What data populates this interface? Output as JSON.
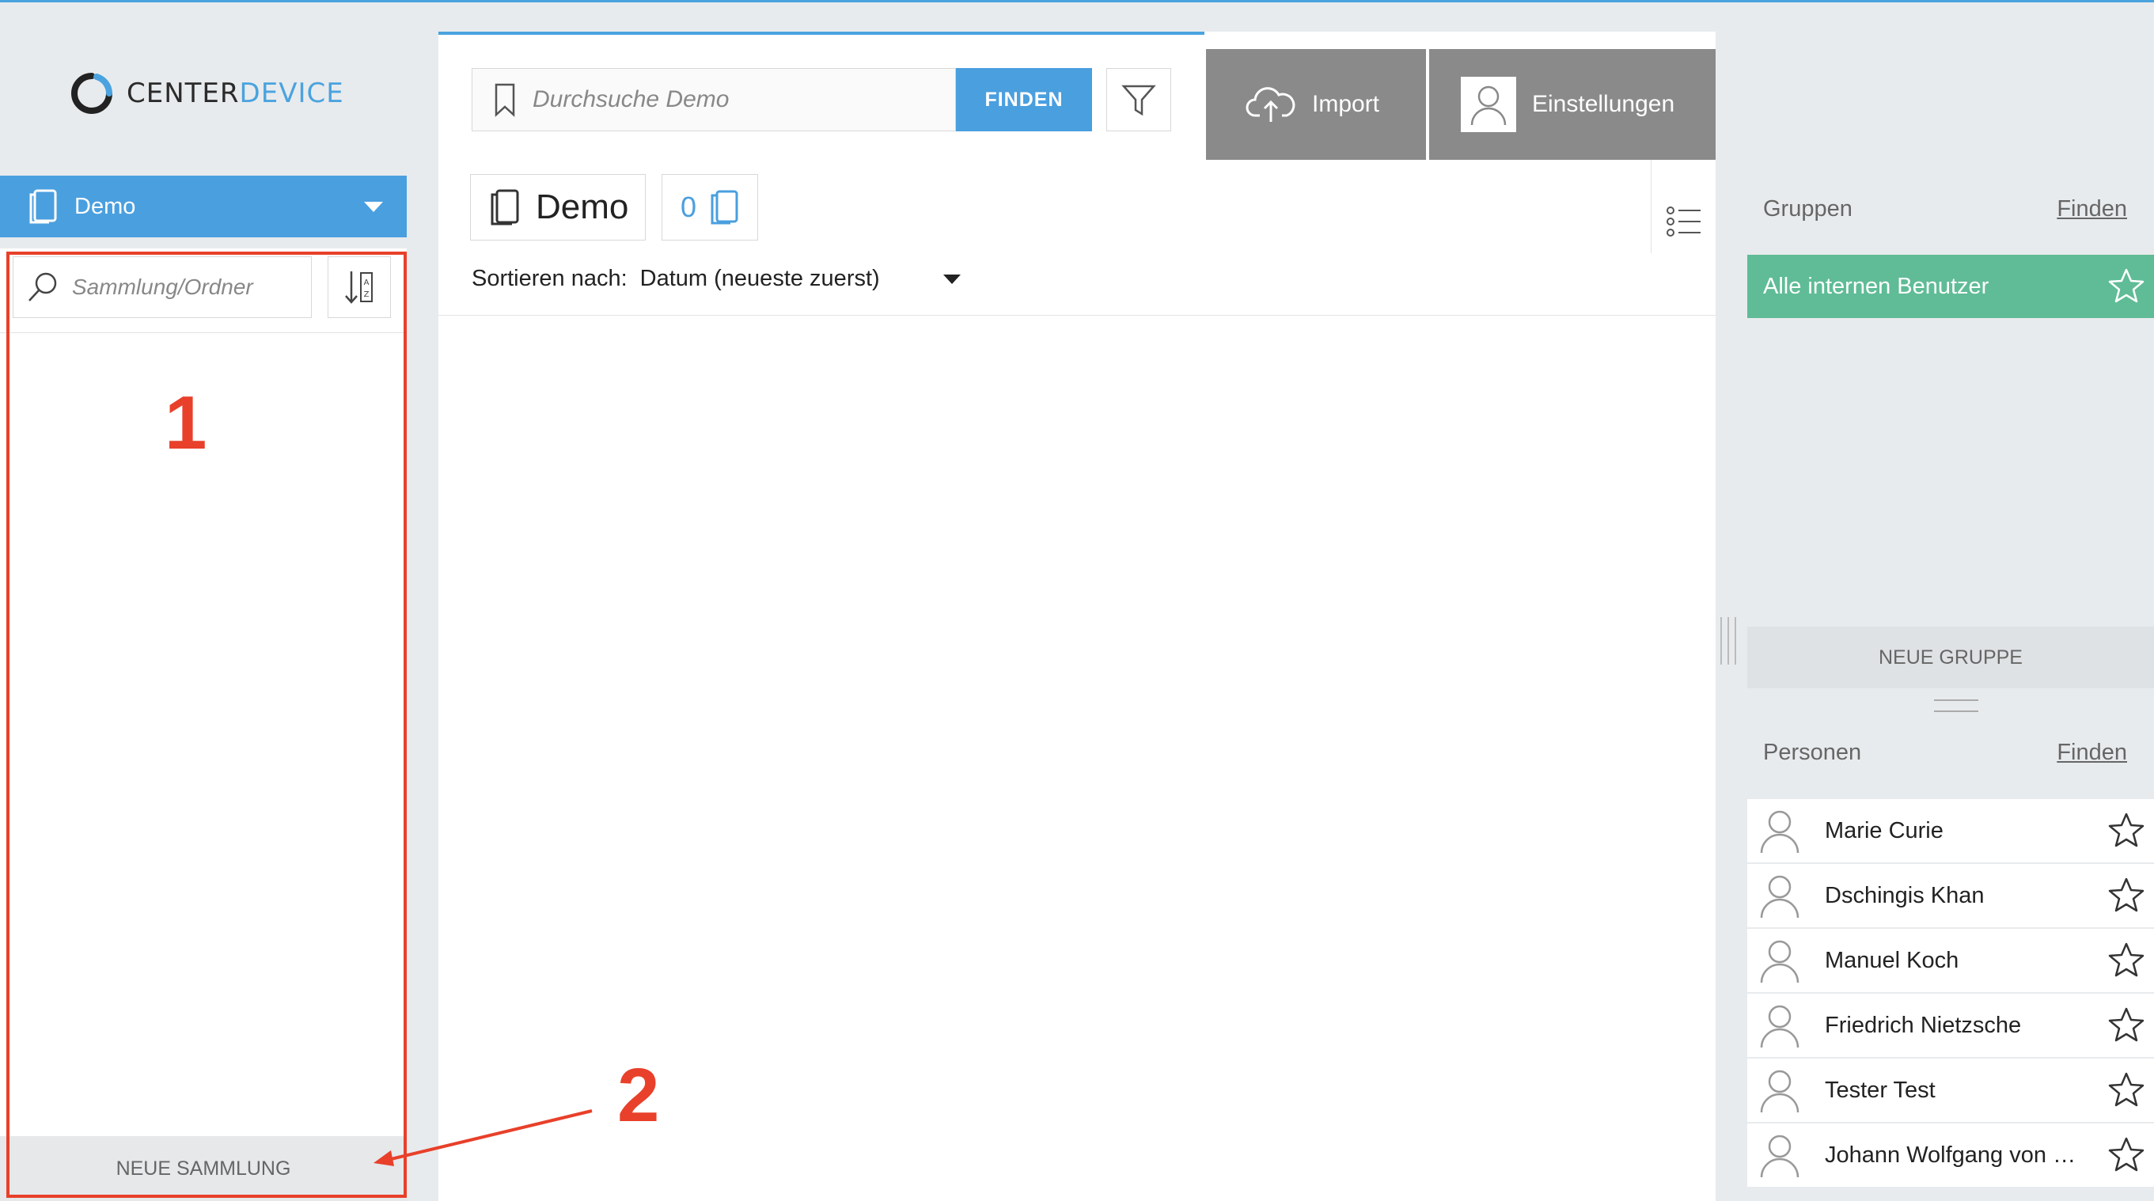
{
  "brand": {
    "name_part1": "CENTER",
    "name_part2": "DEVICE",
    "accent": "#4aa3df"
  },
  "sidebar": {
    "collection_name": "Demo",
    "search_placeholder": "Sammlung/Ordner",
    "new_collection_label": "NEUE SAMMLUNG"
  },
  "search": {
    "placeholder": "Durchsuche Demo",
    "find_label": "FINDEN"
  },
  "toolbar": {
    "import_label": "Import",
    "settings_label": "Einstellungen"
  },
  "main": {
    "title": "Demo",
    "document_count": "0",
    "sort_label": "Sortieren nach:",
    "sort_value": "Datum (neueste zuerst)"
  },
  "groups": {
    "heading": "Gruppen",
    "find_link": "Finden",
    "items": [
      {
        "name": "Alle internen Benutzer"
      }
    ],
    "new_group_label": "NEUE GRUPPE",
    "item_color": "#5fbc96"
  },
  "persons": {
    "heading": "Personen",
    "find_link": "Finden",
    "items": [
      {
        "name": "Marie Curie"
      },
      {
        "name": "Dschingis Khan"
      },
      {
        "name": "Manuel Koch"
      },
      {
        "name": "Friedrich Nietzsche"
      },
      {
        "name": "Tester Test"
      },
      {
        "name": "Johann Wolfgang von Go..."
      }
    ]
  },
  "annotations": {
    "label_1": "1",
    "label_2": "2",
    "color": "#e8402a"
  }
}
